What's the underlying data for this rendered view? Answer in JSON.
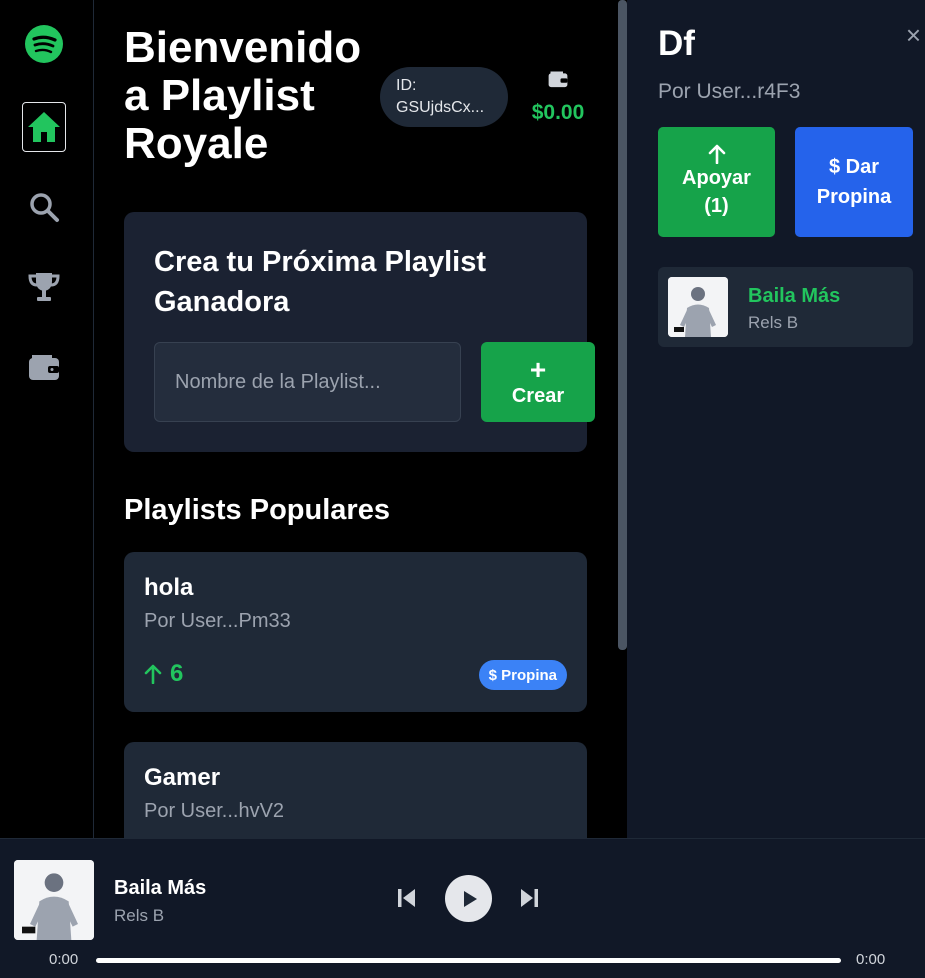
{
  "colors": {
    "accent_green": "#22c55e",
    "button_green": "#16a34a",
    "tip_blue": "#2563eb",
    "pill_blue": "#3b82f6"
  },
  "sidebar": {
    "items": [
      {
        "icon": "spotify-logo-icon"
      },
      {
        "icon": "home-icon",
        "active": true
      },
      {
        "icon": "search-icon"
      },
      {
        "icon": "trophy-icon"
      },
      {
        "icon": "wallet-icon"
      }
    ]
  },
  "header": {
    "title": "Bienvenido a Playlist Royale",
    "id_label": "ID:",
    "id_value": "GSUjdsCx...",
    "balance": "$0.00"
  },
  "create": {
    "title": "Crea tu Próxima Playlist Ganadora",
    "input_placeholder": "Nombre de la Playlist...",
    "input_value": "",
    "button_symbol": "+",
    "button_label": "Crear"
  },
  "popular": {
    "title": "Playlists Populares",
    "playlists": [
      {
        "name": "hola",
        "owner": "Por User...Pm33",
        "votes": "6",
        "tip_label": "$ Propina"
      },
      {
        "name": "Gamer",
        "owner": "Por User...hvV2"
      }
    ]
  },
  "panel": {
    "title": "Df",
    "close_symbol": "×",
    "owner": "Por User...r4F3",
    "support_label": "Apoyar",
    "support_count": "(1)",
    "tip_label": "$ Dar Propina",
    "songs": [
      {
        "title": "Baila Más",
        "artist": "Rels B"
      }
    ]
  },
  "player": {
    "title": "Baila Más",
    "artist": "Rels B",
    "current_time": "0:00",
    "duration": "0:00",
    "progress_fraction": 0
  }
}
